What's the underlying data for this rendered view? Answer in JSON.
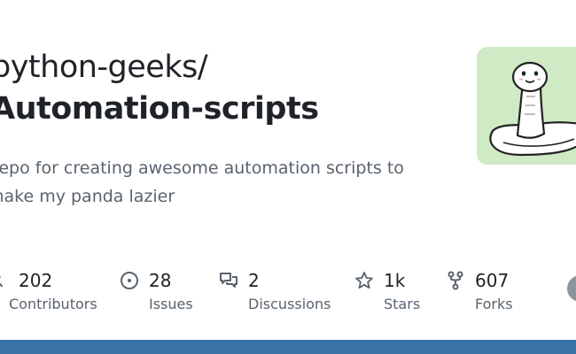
{
  "repo": {
    "owner": "python-geeks/",
    "name": "Automation-scripts",
    "description": "Repo for creating awesome automation scripts to make my panda lazier"
  },
  "stats": [
    {
      "value": "202",
      "label": "Contributors",
      "icon": "people-icon"
    },
    {
      "value": "28",
      "label": "Issues",
      "icon": "issue-icon"
    },
    {
      "value": "2",
      "label": "Discussions",
      "icon": "discussion-icon"
    },
    {
      "value": "1k",
      "label": "Stars",
      "icon": "star-icon"
    },
    {
      "value": "607",
      "label": "Forks",
      "icon": "fork-icon"
    }
  ],
  "colors": {
    "text": "#1f2328",
    "muted": "#59636e",
    "avatar_bg": "#cfeac4",
    "bottom_bar": "#3a73a8"
  }
}
